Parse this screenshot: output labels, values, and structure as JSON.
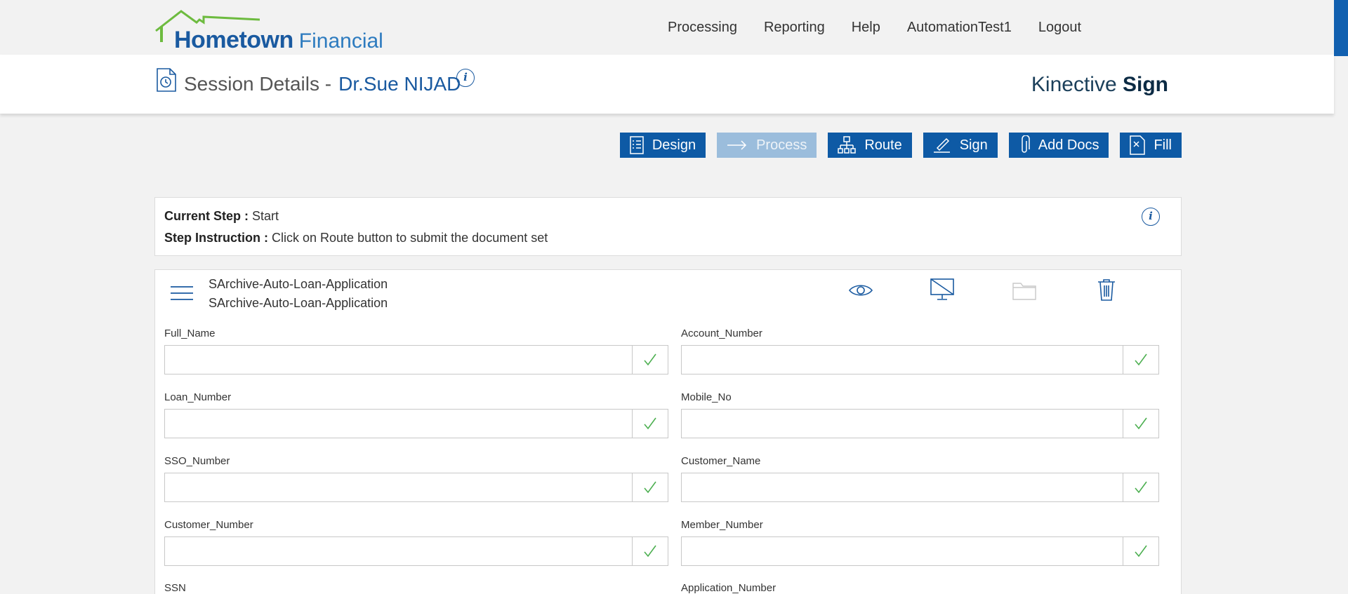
{
  "header": {
    "logo_primary": "Hometown",
    "logo_secondary": "Financial",
    "nav": [
      "Processing",
      "Reporting",
      "Help",
      "AutomationTest1",
      "Logout"
    ]
  },
  "session": {
    "title": "Session Details -",
    "name": "Dr.Sue NIJAD",
    "info_icon": "i",
    "brand_light": "Kinective",
    "brand_bold": "Sign"
  },
  "actions": [
    {
      "label": "Design",
      "icon": "checklist-icon",
      "enabled": true
    },
    {
      "label": "Process",
      "icon": "arrow-right-icon",
      "enabled": false
    },
    {
      "label": "Route",
      "icon": "org-chart-icon",
      "enabled": true
    },
    {
      "label": "Sign",
      "icon": "pen-icon",
      "enabled": true
    },
    {
      "label": "Add Docs",
      "icon": "paperclip-icon",
      "enabled": true
    },
    {
      "label": "Fill",
      "icon": "doc-fill-icon",
      "enabled": true
    }
  ],
  "step": {
    "current_label": "Current Step :",
    "current_value": "Start",
    "instruction_label": "Step Instruction :",
    "instruction_value": "Click on Route button to submit the document set",
    "info_icon": "i"
  },
  "document": {
    "title_line1": "SArchive-Auto-Loan-Application",
    "title_line2": "SArchive-Auto-Loan-Application",
    "tools": [
      "eye-icon",
      "monitor-off-icon",
      "folder-icon",
      "trash-icon"
    ],
    "fields_left": [
      "Full_Name",
      "Loan_Number",
      "SSO_Number",
      "Customer_Number",
      "SSN"
    ],
    "fields_right": [
      "Account_Number",
      "Mobile_No",
      "Customer_Name",
      "Member_Number",
      "Application_Number"
    ]
  },
  "colors": {
    "primary": "#0e5aa5",
    "disabled": "#9bbddc",
    "check": "#4caf50",
    "brand_text": "#0c2b44"
  }
}
